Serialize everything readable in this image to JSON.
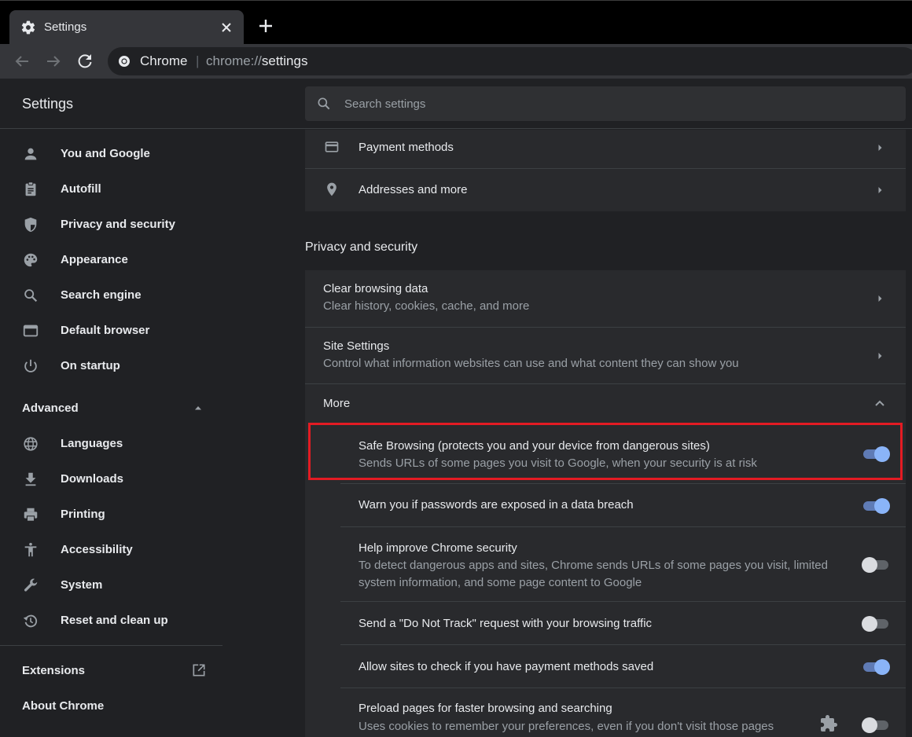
{
  "window": {
    "tab_title": "Settings",
    "tab_icon": "gear-icon"
  },
  "toolbar": {
    "site_name": "Chrome",
    "url_scheme": "chrome://",
    "url_path": "settings"
  },
  "header": {
    "title": "Settings",
    "search_placeholder": "Search settings"
  },
  "sidebar": {
    "items": [
      {
        "label": "You and Google",
        "icon": "person-icon"
      },
      {
        "label": "Autofill",
        "icon": "clipboard-icon"
      },
      {
        "label": "Privacy and security",
        "icon": "shield-icon"
      },
      {
        "label": "Appearance",
        "icon": "palette-icon"
      },
      {
        "label": "Search engine",
        "icon": "search-icon"
      },
      {
        "label": "Default browser",
        "icon": "browser-window-icon"
      },
      {
        "label": "On startup",
        "icon": "power-icon"
      }
    ],
    "advanced_label": "Advanced",
    "advanced_items": [
      {
        "label": "Languages",
        "icon": "globe-icon"
      },
      {
        "label": "Downloads",
        "icon": "download-icon"
      },
      {
        "label": "Printing",
        "icon": "printer-icon"
      },
      {
        "label": "Accessibility",
        "icon": "accessibility-icon"
      },
      {
        "label": "System",
        "icon": "wrench-icon"
      },
      {
        "label": "Reset and clean up",
        "icon": "restore-icon"
      }
    ],
    "extensions_label": "Extensions",
    "about_label": "About Chrome"
  },
  "autofill_card": {
    "payment_methods": "Payment methods",
    "addresses": "Addresses and more"
  },
  "privacy": {
    "section_title": "Privacy and security",
    "clear_title": "Clear browsing data",
    "clear_sub": "Clear history, cookies, cache, and more",
    "site_title": "Site Settings",
    "site_sub": "Control what information websites can use and what content they can show you",
    "more_label": "More",
    "toggles": [
      {
        "title": "Safe Browsing (protects you and your device from dangerous sites)",
        "sub": "Sends URLs of some pages you visit to Google, when your security is at risk",
        "on": true
      },
      {
        "title": "Warn you if passwords are exposed in a data breach",
        "sub": "",
        "on": true
      },
      {
        "title": "Help improve Chrome security",
        "sub": "To detect dangerous apps and sites, Chrome sends URLs of some pages you visit, limited",
        "sub2": "system information, and some page content to Google",
        "on": false
      },
      {
        "title": "Send a \"Do Not Track\" request with your browsing traffic",
        "sub": "",
        "on": false
      },
      {
        "title": "Allow sites to check if you have payment methods saved",
        "sub": "",
        "on": true
      },
      {
        "title": "Preload pages for faster browsing and searching",
        "sub": "Uses cookies to remember your preferences, even if you don't visit those pages",
        "on": false
      }
    ]
  },
  "colors": {
    "accent": "#8ab4f8",
    "highlight_border": "#e31b23"
  }
}
